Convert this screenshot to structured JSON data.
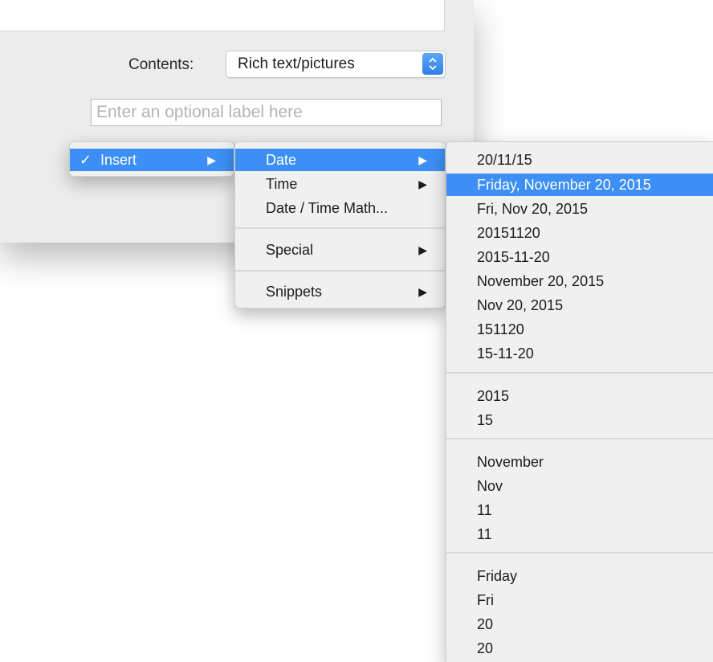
{
  "panel": {
    "contents_label": "Contents:",
    "contents_value": "Rich text/pictures",
    "label_placeholder": "Enter an optional label here"
  },
  "insert_menu": {
    "check": "✓",
    "label": "Insert",
    "arrow": "▶"
  },
  "submenu": {
    "items": [
      {
        "label": "Date",
        "arrow": "▶"
      },
      {
        "label": "Time",
        "arrow": "▶"
      },
      {
        "label": "Date / Time Math..."
      },
      {
        "label": "Special",
        "arrow": "▶"
      },
      {
        "label": "Snippets",
        "arrow": "▶"
      }
    ]
  },
  "date_menu": {
    "items": [
      "20/11/15",
      "Friday, November 20, 2015",
      "Fri, Nov 20, 2015",
      "20151120",
      "2015-11-20",
      "November 20, 2015",
      "Nov 20, 2015",
      "151120",
      "15-11-20",
      "2015",
      "15",
      "November",
      "Nov",
      "11",
      "11",
      "Friday",
      "Fri",
      "20",
      "20"
    ]
  },
  "colors": {
    "highlight": "#3d8ff5",
    "menu_bg": "#f0f0f0",
    "panel_bg": "#ececec"
  }
}
